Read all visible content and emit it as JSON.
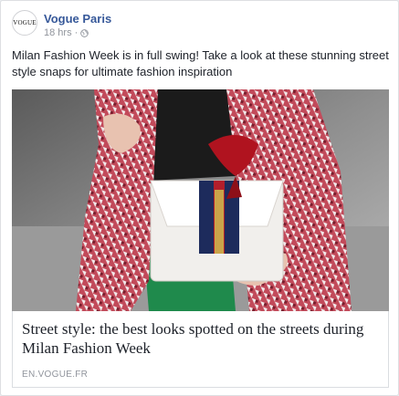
{
  "post": {
    "avatar_text": "VOGUE",
    "page_name": "Vogue Paris",
    "time": "18 hrs",
    "separator": "·",
    "privacy_icon": "globe-icon",
    "text": "Milan Fashion Week is in full swing! Take a look at these stunning street style snaps for ultimate fashion inspiration"
  },
  "link_preview": {
    "image_icon": "street-style-photo",
    "title": "Street style: the best looks spotted on the streets during Milan Fashion Week",
    "domain": "EN.VOGUE.FR"
  },
  "colors": {
    "page_name": "#365899",
    "meta": "#90949c",
    "text": "#1d2129",
    "border": "#dddfe2"
  }
}
